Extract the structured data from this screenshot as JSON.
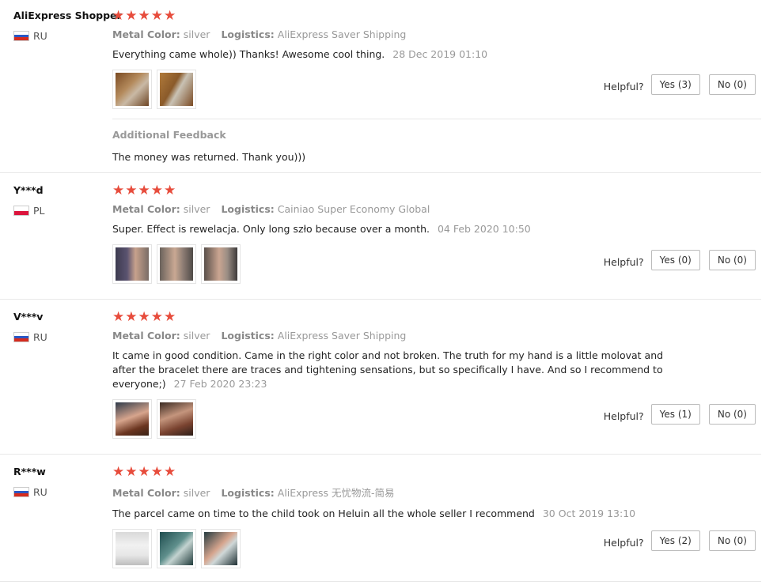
{
  "labels": {
    "metal_color": "Metal Color:",
    "logistics": "Logistics:",
    "helpful": "Helpful?",
    "additional_feedback": "Additional Feedback"
  },
  "colors": {
    "star": "#e74c3c",
    "divider": "#e8e8e8",
    "muted": "#999999"
  },
  "reviews": [
    {
      "user": "AliExpress Shopper",
      "country": "RU",
      "flag": [
        "#ffffff",
        "#2a57c4",
        "#d52b1e"
      ],
      "stars": 5,
      "metal_color": "silver",
      "logistics": "AliExpress Saver Shipping",
      "text": "Everything came whole)) Thanks! Awesome cool thing.",
      "date": "28 Dec 2019 01:10",
      "yes": "Yes (3)",
      "no": "No (0)",
      "thumbs": [
        {
          "name": "review-photo-1",
          "bg": "linear-gradient(135deg,#7a4a22 0%,#b48a5c 40%,#c9b9a5 60%,#6d4524 100%)"
        },
        {
          "name": "review-photo-2",
          "bg": "linear-gradient(120deg,#b07a3b 0%,#8a5a2a 40%,#c9c2b4 55%,#7b4b24 100%)"
        }
      ],
      "additional": "The money was returned. Thank you)))"
    },
    {
      "user": "Y***d",
      "country": "PL",
      "flag": [
        "#ffffff",
        "#dc143c"
      ],
      "stars": 5,
      "metal_color": "silver",
      "logistics": "Cainiao Super Economy Global",
      "text": "Super. Effect is rewelacja. Only long szło because over a month.",
      "date": "04 Feb 2020 10:50",
      "yes": "Yes (0)",
      "no": "No (0)",
      "thumbs": [
        {
          "name": "review-photo-1",
          "bg": "linear-gradient(90deg,#3c3a4f 0%,#5b5370 35%,#c7a18c 60%,#7a6c66 100%)"
        },
        {
          "name": "review-photo-2",
          "bg": "linear-gradient(90deg,#6b625c 0%,#c9a893 45%,#8d7d74 70%,#4f4a47 100%)"
        },
        {
          "name": "review-photo-3",
          "bg": "linear-gradient(90deg,#5a504a 0%,#caa591 45%,#9a8d84 70%,#3d3a3a 100%)"
        }
      ],
      "additional": null
    },
    {
      "user": "V***v",
      "country": "RU",
      "flag": [
        "#ffffff",
        "#2a57c4",
        "#d52b1e"
      ],
      "stars": 5,
      "metal_color": "silver",
      "logistics": "AliExpress Saver Shipping",
      "text": "It came in good condition. Came in the right color and not broken. The truth for my hand is a little molovat and after the bracelet there are traces and tightening sensations, but so specifically I have. And so I recommend to everyone;)",
      "date": "27 Feb 2020 23:23",
      "yes": "Yes (1)",
      "no": "No (0)",
      "thumbs": [
        {
          "name": "review-photo-1",
          "bg": "linear-gradient(160deg,#2e3a4a 0%,#d7a58d 45%,#6b3520 75%,#3a2316 100%)"
        },
        {
          "name": "review-photo-2",
          "bg": "linear-gradient(160deg,#3a2a22 0%,#c4957d 40%,#7a4330 70%,#2c1e18 100%)"
        }
      ],
      "additional": null
    },
    {
      "user": "R***w",
      "country": "RU",
      "flag": [
        "#ffffff",
        "#2a57c4",
        "#d52b1e"
      ],
      "stars": 5,
      "metal_color": "silver",
      "logistics": "AliExpress 无忧物流-简易",
      "text": "The parcel came on time to the child took on Heluin all the whole seller I recommend",
      "date": "30 Oct 2019 13:10",
      "yes": "Yes (2)",
      "no": "No (0)",
      "thumbs": [
        {
          "name": "review-photo-1",
          "bg": "linear-gradient(180deg,#d9d9d9 0%,#f1f1f1 40%,#e6e6e6 70%,#bdbdbd 100%)"
        },
        {
          "name": "review-photo-2",
          "bg": "linear-gradient(135deg,#1f4d4f 0%,#5f8f8c 45%,#c3d3d0 60%,#203b3b 100%)"
        },
        {
          "name": "review-photo-3",
          "bg": "linear-gradient(135deg,#243a40 0%,#d6a58e 45%,#cfd8d8 60%,#1e2f33 100%)"
        }
      ],
      "additional": null
    }
  ]
}
